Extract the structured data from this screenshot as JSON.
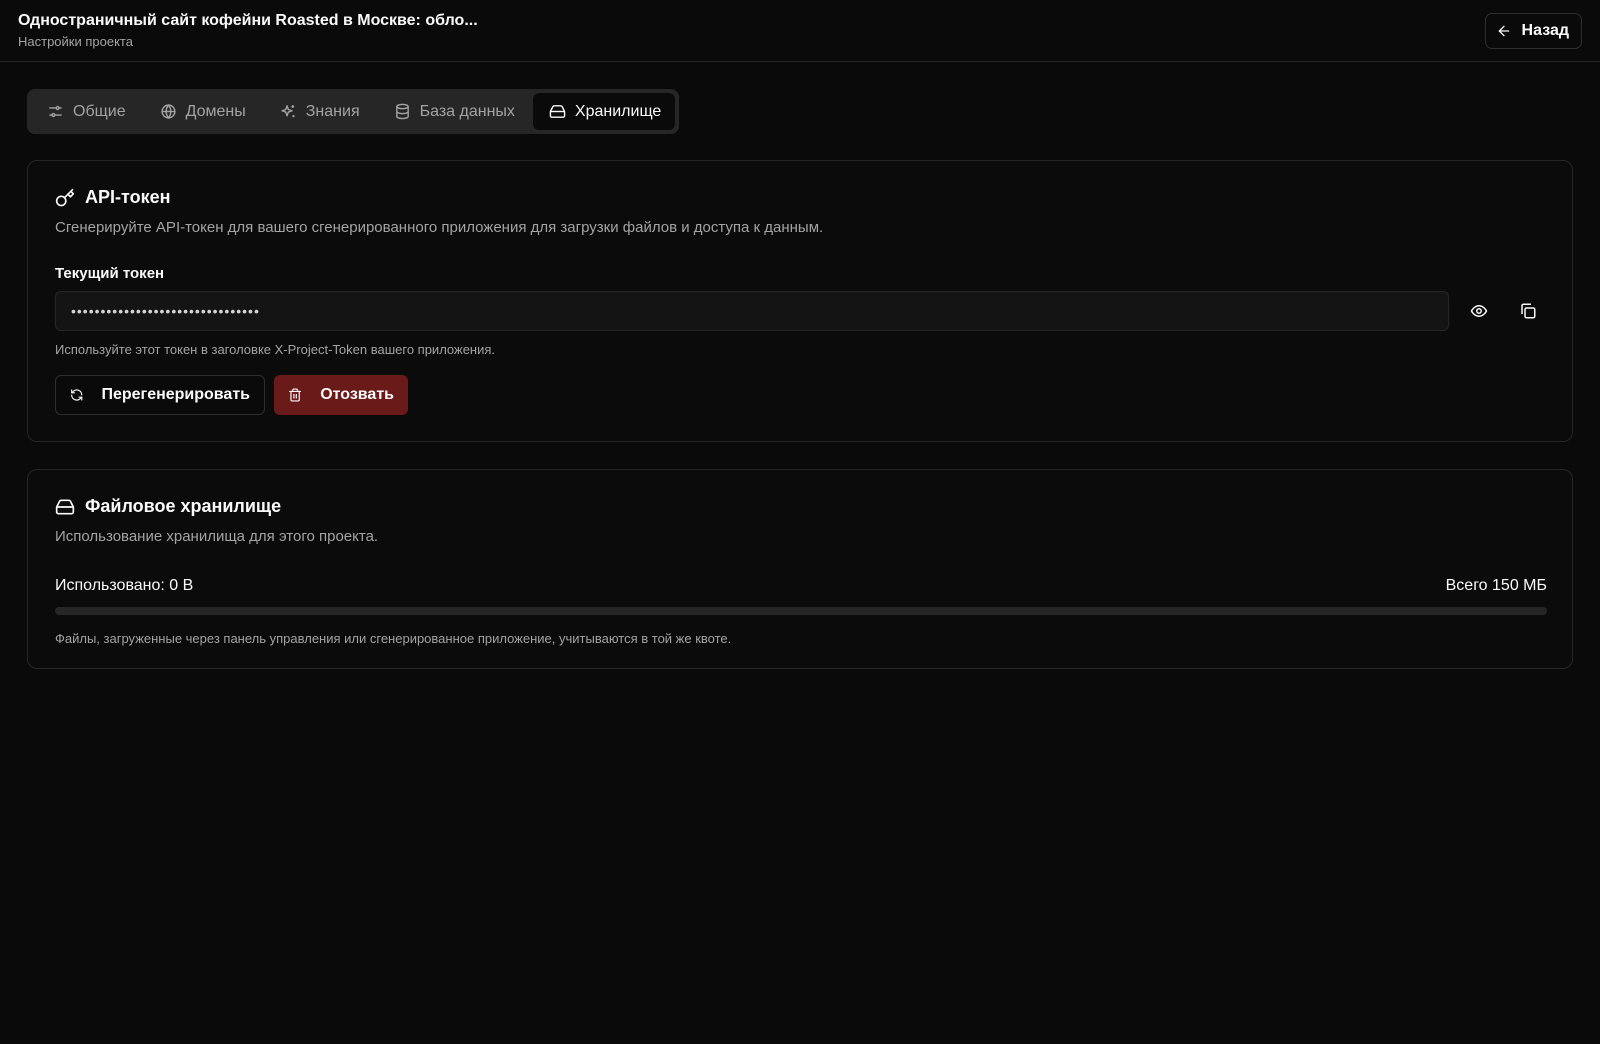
{
  "header": {
    "title": "Одностраничный сайт кофейни Roasted в Москве: обло...",
    "subtitle": "Настройки проекта",
    "back_label": "Назад"
  },
  "tabs": [
    {
      "label": "Общие",
      "icon": "sliders-icon"
    },
    {
      "label": "Домены",
      "icon": "globe-icon"
    },
    {
      "label": "Знания",
      "icon": "sparkles-icon"
    },
    {
      "label": "База данных",
      "icon": "database-icon"
    },
    {
      "label": "Хранилище",
      "icon": "hard-drive-icon",
      "active": true
    }
  ],
  "api_card": {
    "title": "API-токен",
    "description": "Сгенерируйте API-токен для вашего сгенерированного приложения для загрузки файлов и доступа к данным.",
    "field_label": "Текущий токен",
    "token_value": "••••••••••••••••••••••••••••••••",
    "hint": "Используйте этот токен в заголовке X-Project-Token вашего приложения.",
    "regenerate_label": "Перегенерировать",
    "revoke_label": "Отозвать"
  },
  "storage_card": {
    "title": "Файловое хранилище",
    "description": "Использование хранилища для этого проекта.",
    "used_label": "Использовано: 0 B",
    "total_label": "Всего 150 МБ",
    "usage_fraction": 0,
    "hint": "Файлы, загруженные через панель управления или сгенерированное приложение, учитываются в той же квоте."
  },
  "colors": {
    "background": "#0a0a0a",
    "border": "#262626",
    "muted_text": "#a3a3a3",
    "danger": "#6b1a1a"
  }
}
